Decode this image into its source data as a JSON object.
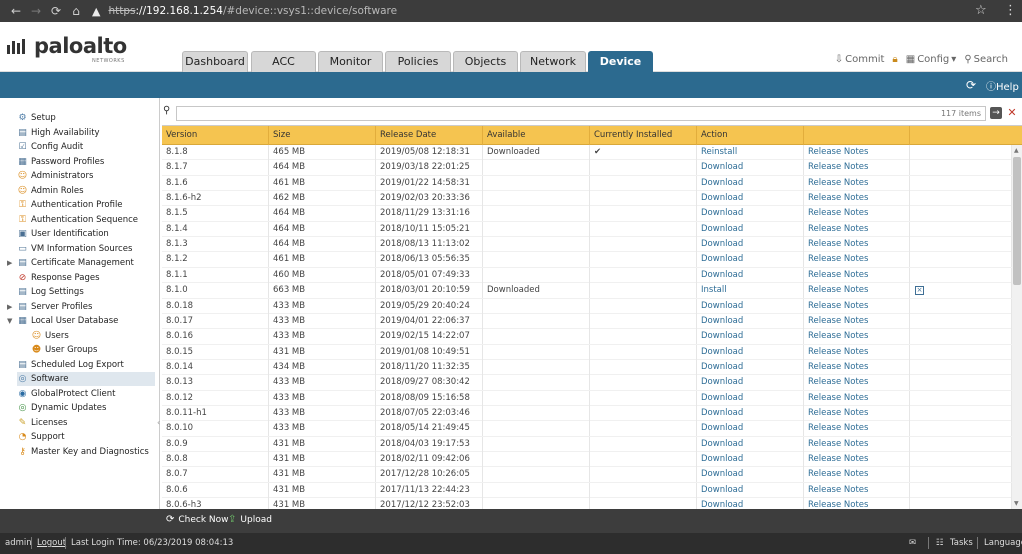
{
  "browser": {
    "url_scheme": "https",
    "url_host": "://192.168.1.254",
    "url_path": "/#device::vsys1::device/software"
  },
  "header": {
    "logo_text": "paloalto",
    "logo_sub": "NETWORKS",
    "tabs": [
      "Dashboard",
      "ACC",
      "Monitor",
      "Policies",
      "Objects",
      "Network",
      "Device"
    ],
    "active_tab": "Device",
    "actions": {
      "commit": "Commit",
      "config": "Config",
      "search": "Search"
    },
    "help": "Help"
  },
  "sidebar": {
    "items": [
      {
        "label": "Setup",
        "icon": "setup-icon",
        "level": 0
      },
      {
        "label": "High Availability",
        "icon": "ha-icon",
        "level": 0
      },
      {
        "label": "Config Audit",
        "icon": "audit-icon",
        "level": 0
      },
      {
        "label": "Password Profiles",
        "icon": "password-icon",
        "level": 0
      },
      {
        "label": "Administrators",
        "icon": "admin-icon",
        "level": 0
      },
      {
        "label": "Admin Roles",
        "icon": "roles-icon",
        "level": 0
      },
      {
        "label": "Authentication Profile",
        "icon": "auth-profile-icon",
        "level": 0
      },
      {
        "label": "Authentication Sequence",
        "icon": "auth-seq-icon",
        "level": 0
      },
      {
        "label": "User Identification",
        "icon": "user-id-icon",
        "level": 0
      },
      {
        "label": "VM Information Sources",
        "icon": "vm-icon",
        "level": 0
      },
      {
        "label": "Certificate Management",
        "icon": "cert-icon",
        "level": 0,
        "expander": "right"
      },
      {
        "label": "Response Pages",
        "icon": "response-icon",
        "level": 0
      },
      {
        "label": "Log Settings",
        "icon": "log-icon",
        "level": 0
      },
      {
        "label": "Server Profiles",
        "icon": "server-icon",
        "level": 0,
        "expander": "right"
      },
      {
        "label": "Local User Database",
        "icon": "db-icon",
        "level": 0,
        "expander": "down"
      },
      {
        "label": "Users",
        "icon": "users-icon",
        "level": 1
      },
      {
        "label": "User Groups",
        "icon": "groups-icon",
        "level": 1
      },
      {
        "label": "Scheduled Log Export",
        "icon": "export-icon",
        "level": 0
      },
      {
        "label": "Software",
        "icon": "software-icon",
        "level": 0,
        "selected": true
      },
      {
        "label": "GlobalProtect Client",
        "icon": "gp-icon",
        "level": 0
      },
      {
        "label": "Dynamic Updates",
        "icon": "updates-icon",
        "level": 0
      },
      {
        "label": "Licenses",
        "icon": "license-icon",
        "level": 0
      },
      {
        "label": "Support",
        "icon": "support-icon",
        "level": 0
      },
      {
        "label": "Master Key and Diagnostics",
        "icon": "masterkey-icon",
        "level": 0
      }
    ]
  },
  "filter": {
    "placeholder": "",
    "count_text": "117 items"
  },
  "grid": {
    "columns": [
      "Version",
      "Size",
      "Release Date",
      "Available",
      "Currently Installed",
      "Action",
      "",
      ""
    ],
    "rows": [
      {
        "version": "8.1.8",
        "size": "465 MB",
        "date": "2019/05/08 12:18:31",
        "available": "Downloaded",
        "installed": "✔",
        "action": "Reinstall",
        "notes": "Release Notes",
        "del": ""
      },
      {
        "version": "8.1.7",
        "size": "464 MB",
        "date": "2019/03/18 22:01:25",
        "available": "",
        "installed": "",
        "action": "Download",
        "notes": "Release Notes",
        "del": ""
      },
      {
        "version": "8.1.6",
        "size": "461 MB",
        "date": "2019/01/22 14:58:31",
        "available": "",
        "installed": "",
        "action": "Download",
        "notes": "Release Notes",
        "del": ""
      },
      {
        "version": "8.1.6-h2",
        "size": "462 MB",
        "date": "2019/02/03 20:33:36",
        "available": "",
        "installed": "",
        "action": "Download",
        "notes": "Release Notes",
        "del": ""
      },
      {
        "version": "8.1.5",
        "size": "464 MB",
        "date": "2018/11/29 13:31:16",
        "available": "",
        "installed": "",
        "action": "Download",
        "notes": "Release Notes",
        "del": ""
      },
      {
        "version": "8.1.4",
        "size": "464 MB",
        "date": "2018/10/11 15:05:21",
        "available": "",
        "installed": "",
        "action": "Download",
        "notes": "Release Notes",
        "del": ""
      },
      {
        "version": "8.1.3",
        "size": "464 MB",
        "date": "2018/08/13 11:13:02",
        "available": "",
        "installed": "",
        "action": "Download",
        "notes": "Release Notes",
        "del": ""
      },
      {
        "version": "8.1.2",
        "size": "461 MB",
        "date": "2018/06/13 05:56:35",
        "available": "",
        "installed": "",
        "action": "Download",
        "notes": "Release Notes",
        "del": ""
      },
      {
        "version": "8.1.1",
        "size": "460 MB",
        "date": "2018/05/01 07:49:33",
        "available": "",
        "installed": "",
        "action": "Download",
        "notes": "Release Notes",
        "del": ""
      },
      {
        "version": "8.1.0",
        "size": "663 MB",
        "date": "2018/03/01 20:10:59",
        "available": "Downloaded",
        "installed": "",
        "action": "Install",
        "notes": "Release Notes",
        "del": "x"
      },
      {
        "version": "8.0.18",
        "size": "433 MB",
        "date": "2019/05/29 20:40:24",
        "available": "",
        "installed": "",
        "action": "Download",
        "notes": "Release Notes",
        "del": ""
      },
      {
        "version": "8.0.17",
        "size": "433 MB",
        "date": "2019/04/01 22:06:37",
        "available": "",
        "installed": "",
        "action": "Download",
        "notes": "Release Notes",
        "del": ""
      },
      {
        "version": "8.0.16",
        "size": "433 MB",
        "date": "2019/02/15 14:22:07",
        "available": "",
        "installed": "",
        "action": "Download",
        "notes": "Release Notes",
        "del": ""
      },
      {
        "version": "8.0.15",
        "size": "431 MB",
        "date": "2019/01/08 10:49:51",
        "available": "",
        "installed": "",
        "action": "Download",
        "notes": "Release Notes",
        "del": ""
      },
      {
        "version": "8.0.14",
        "size": "434 MB",
        "date": "2018/11/20 11:32:35",
        "available": "",
        "installed": "",
        "action": "Download",
        "notes": "Release Notes",
        "del": ""
      },
      {
        "version": "8.0.13",
        "size": "433 MB",
        "date": "2018/09/27 08:30:42",
        "available": "",
        "installed": "",
        "action": "Download",
        "notes": "Release Notes",
        "del": ""
      },
      {
        "version": "8.0.12",
        "size": "433 MB",
        "date": "2018/08/09 15:16:58",
        "available": "",
        "installed": "",
        "action": "Download",
        "notes": "Release Notes",
        "del": ""
      },
      {
        "version": "8.0.11-h1",
        "size": "433 MB",
        "date": "2018/07/05 22:03:46",
        "available": "",
        "installed": "",
        "action": "Download",
        "notes": "Release Notes",
        "del": ""
      },
      {
        "version": "8.0.10",
        "size": "433 MB",
        "date": "2018/05/14 21:49:45",
        "available": "",
        "installed": "",
        "action": "Download",
        "notes": "Release Notes",
        "del": ""
      },
      {
        "version": "8.0.9",
        "size": "431 MB",
        "date": "2018/04/03 19:17:53",
        "available": "",
        "installed": "",
        "action": "Download",
        "notes": "Release Notes",
        "del": ""
      },
      {
        "version": "8.0.8",
        "size": "431 MB",
        "date": "2018/02/11 09:42:06",
        "available": "",
        "installed": "",
        "action": "Download",
        "notes": "Release Notes",
        "del": ""
      },
      {
        "version": "8.0.7",
        "size": "431 MB",
        "date": "2017/12/28 10:26:05",
        "available": "",
        "installed": "",
        "action": "Download",
        "notes": "Release Notes",
        "del": ""
      },
      {
        "version": "8.0.6",
        "size": "431 MB",
        "date": "2017/11/13 22:44:23",
        "available": "",
        "installed": "",
        "action": "Download",
        "notes": "Release Notes",
        "del": ""
      },
      {
        "version": "8.0.6-h3",
        "size": "431 MB",
        "date": "2017/12/12 23:52:03",
        "available": "",
        "installed": "",
        "action": "Download",
        "notes": "Release Notes",
        "del": ""
      }
    ]
  },
  "bottom_bar": {
    "check_now": "Check Now",
    "upload": "Upload"
  },
  "status_bar": {
    "user": "admin",
    "logout": "Logout",
    "last_login": "Last Login Time: 06/23/2019 08:04:13",
    "tasks": "Tasks",
    "language": "Language"
  },
  "colors": {
    "accent": "#2c6a8f",
    "grid_header": "#f5c450",
    "link": "#2e6d96"
  }
}
